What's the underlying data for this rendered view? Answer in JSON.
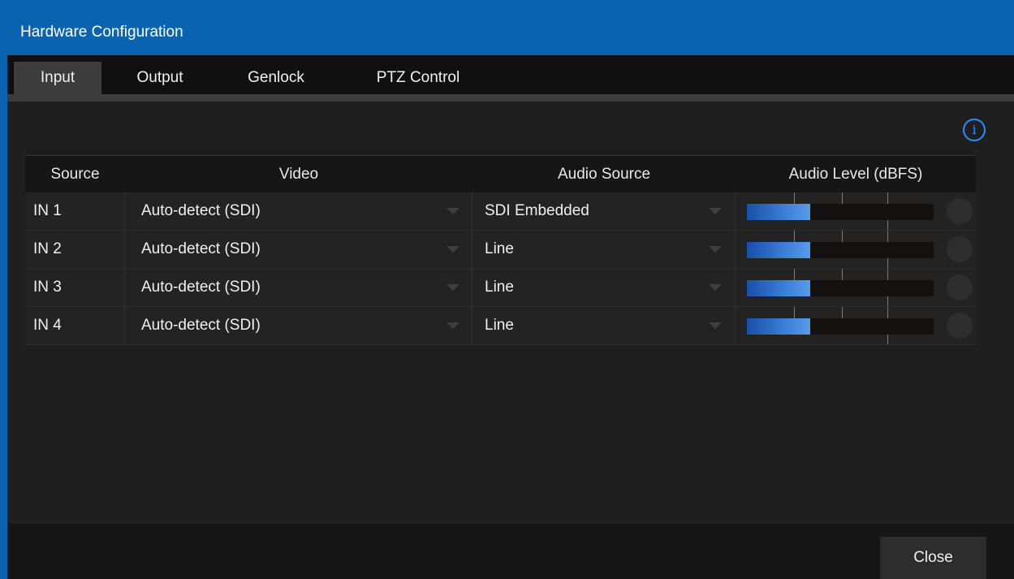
{
  "window": {
    "title": "Hardware Configuration"
  },
  "tabs": [
    {
      "label": "Input",
      "active": true
    },
    {
      "label": "Output",
      "active": false
    },
    {
      "label": "Genlock",
      "active": false
    },
    {
      "label": "PTZ Control",
      "active": false
    }
  ],
  "info_icon": {
    "icon": "info-icon",
    "glyph": "i",
    "color": "#2a8bff"
  },
  "table": {
    "headers": {
      "source": "Source",
      "video": "Video",
      "audio_source": "Audio Source",
      "audio_level": "Audio Level (dBFS)"
    },
    "rows": [
      {
        "source": "IN 1",
        "video": "Auto-detect (SDI)",
        "audio_source": "SDI Embedded",
        "level_fraction": 0.34
      },
      {
        "source": "IN 2",
        "video": "Auto-detect (SDI)",
        "audio_source": "Line",
        "level_fraction": 0.34
      },
      {
        "source": "IN 3",
        "video": "Auto-detect (SDI)",
        "audio_source": "Line",
        "level_fraction": 0.34
      },
      {
        "source": "IN 4",
        "video": "Auto-detect (SDI)",
        "audio_source": "Line",
        "level_fraction": 0.34
      }
    ]
  },
  "footer": {
    "close_label": "Close"
  },
  "colors": {
    "accent": "#0a63b0",
    "meter_fill": "#3a7fd8"
  }
}
